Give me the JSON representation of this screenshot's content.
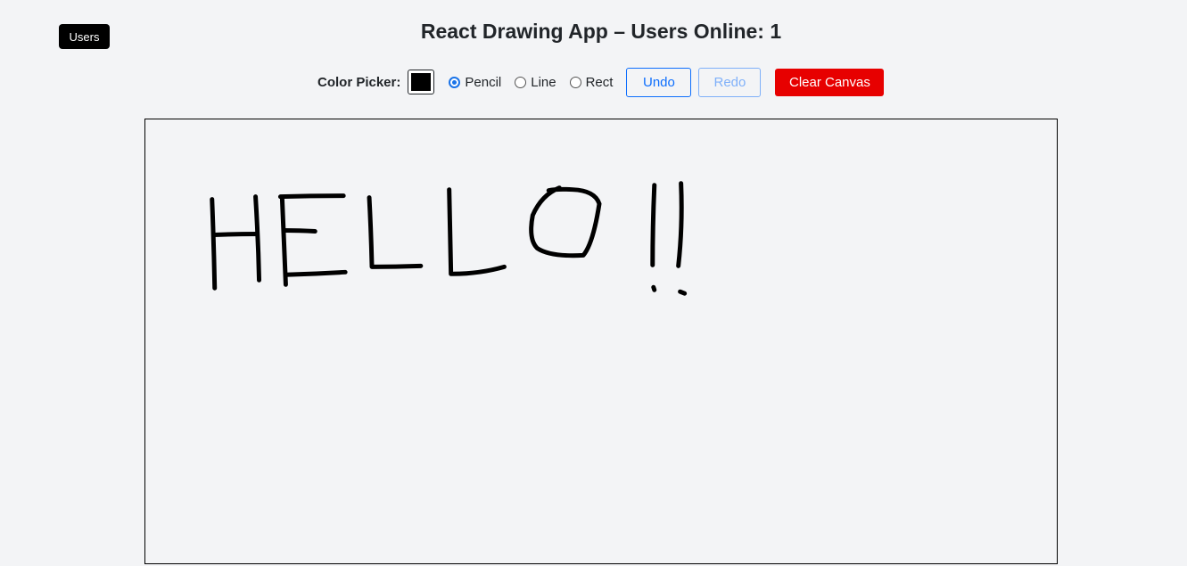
{
  "header": {
    "users_label": "Users",
    "title": "React Drawing App – Users Online: 1"
  },
  "toolbar": {
    "color_label": "Color Picker:",
    "selected_color": "#000000",
    "tools": [
      {
        "label": "Pencil",
        "checked": true
      },
      {
        "label": "Line",
        "checked": false
      },
      {
        "label": "Rect",
        "checked": false
      }
    ],
    "undo_label": "Undo",
    "redo_label": "Redo",
    "redo_disabled": true,
    "clear_label": "Clear Canvas"
  },
  "colors": {
    "accent": "#0d6efd",
    "danger": "#e70000",
    "background": "#f3f4f6",
    "stroke": "#000000"
  }
}
